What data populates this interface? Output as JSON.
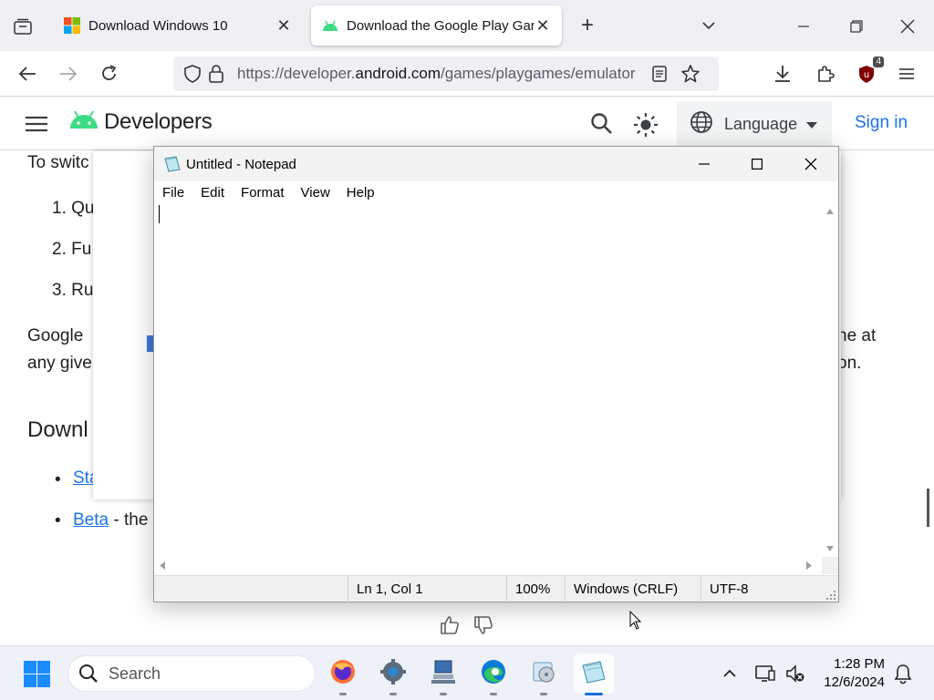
{
  "browser": {
    "tabs": [
      {
        "title": "Download Windows 10",
        "favicon": "microsoft-icon",
        "active": false
      },
      {
        "title": "Download the Google Play Games",
        "favicon": "android-icon",
        "active": true
      }
    ],
    "url_prefix": "https://developer.",
    "url_domain": "android.com",
    "url_path": "/games/playgames/emulator",
    "extension_badge": "4"
  },
  "site_header": {
    "brand": "Developers",
    "language_label": "Language",
    "signin_label": "Sign in"
  },
  "article": {
    "intro_fragment": "To switc",
    "list_items": [
      "1. Qu",
      "2. Fu",
      "3. Ru"
    ],
    "para_line1_left": "Google",
    "para_line1_right": "he at",
    "para_line2_left": "any give",
    "para_line2_right": "on.",
    "section_heading": "Downl",
    "link_stable": "Sta",
    "link_beta": "Beta",
    "beta_suffix": " - the"
  },
  "notepad": {
    "title": "Untitled - Notepad",
    "menu": [
      "File",
      "Edit",
      "Format",
      "View",
      "Help"
    ],
    "content": "",
    "status": {
      "position": "Ln 1, Col 1",
      "zoom": "100%",
      "line_ending": "Windows (CRLF)",
      "encoding": "UTF-8"
    }
  },
  "taskbar": {
    "search_placeholder": "Search",
    "apps": [
      "firefox-icon",
      "settings-icon",
      "network-pc-icon",
      "edge-icon",
      "media-player-icon",
      "notepad-icon"
    ],
    "time": "1:28 PM",
    "date": "12/6/2024"
  },
  "colors": {
    "link": "#1a73e8",
    "android_green": "#3ddc84",
    "taskbar_bg": "#eef1f8"
  }
}
